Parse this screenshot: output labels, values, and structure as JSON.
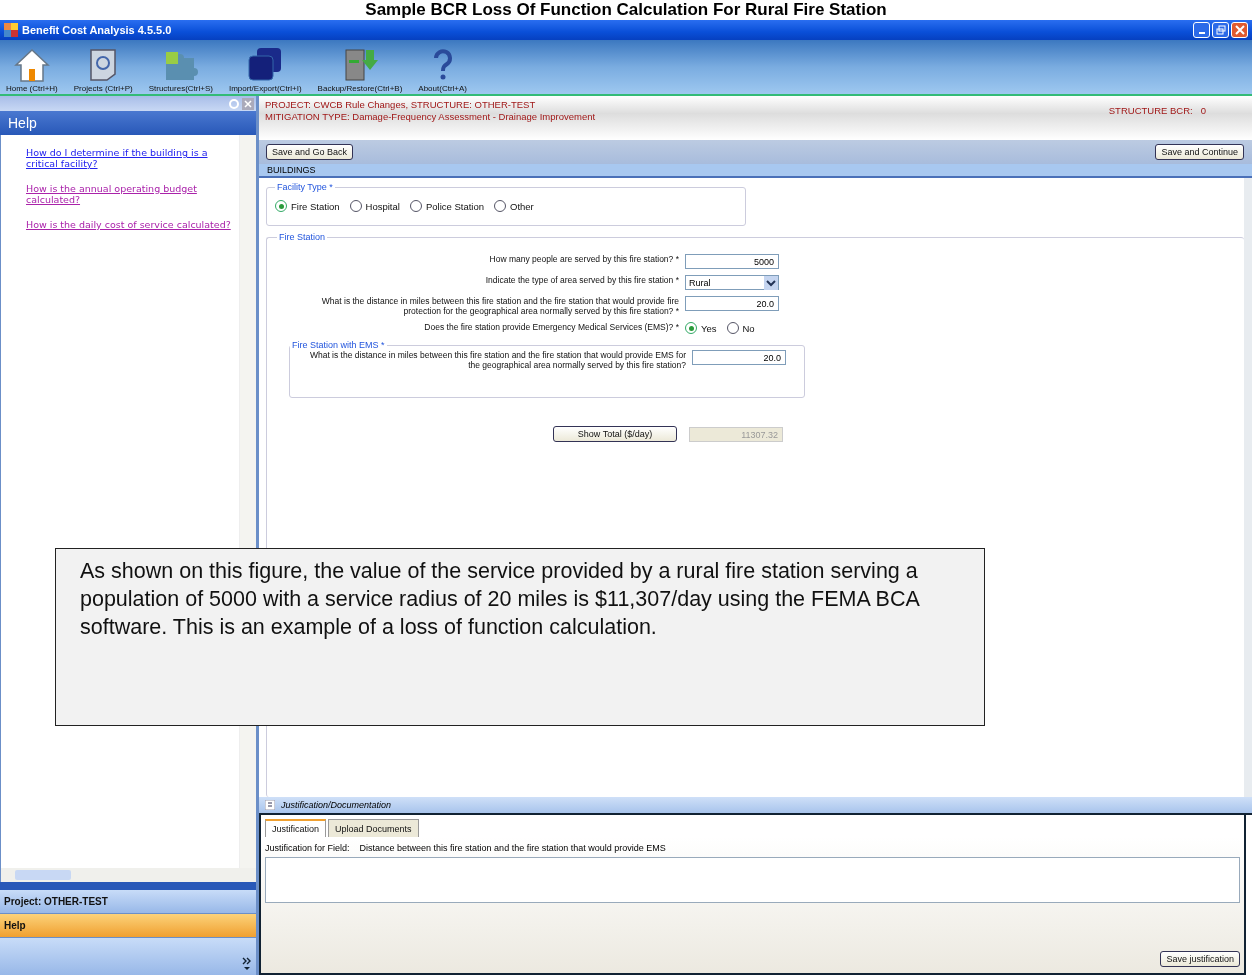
{
  "slide_title": "Sample BCR Loss Of Function Calculation For Rural Fire Station",
  "window": {
    "title": "Benefit Cost Analysis 4.5.5.0"
  },
  "toolbar": [
    {
      "kind": "home",
      "label": "Home (Ctrl+H)"
    },
    {
      "kind": "projects",
      "label": "Projects (Ctrl+P)"
    },
    {
      "kind": "structures",
      "label": "Structures(Ctrl+S)"
    },
    {
      "kind": "import",
      "label": "Import/Export(Ctrl+I)"
    },
    {
      "kind": "backup",
      "label": "Backup/Restore(Ctrl+B)"
    },
    {
      "kind": "about",
      "label": "About(Ctrl+A)"
    }
  ],
  "help_panel": {
    "title": "Help",
    "links": [
      {
        "text": "How do I determine if the building is a critical facility?",
        "visited": false
      },
      {
        "text": "How is the annual operating budget calculated?",
        "visited": true
      },
      {
        "text": "How is the daily cost of service calculated?",
        "visited": true
      }
    ]
  },
  "sidebar_sections": [
    {
      "label": "Project: OTHER-TEST",
      "selected": false
    },
    {
      "label": "Help",
      "selected": true
    }
  ],
  "header": {
    "project": "PROJECT: CWCB Rule Changes, STRUCTURE: OTHER-TEST",
    "mitigation": "MITIGATION TYPE: Damage-Frequency Assessment - Drainage Improvement",
    "bcr_label": "STRUCTURE BCR:",
    "bcr_value": "0"
  },
  "back_button": "Save and Go Back",
  "continue_button": "Save and Continue",
  "section": "BUILDINGS",
  "facility_type": {
    "legend": "Facility Type *",
    "options": [
      {
        "label": "Fire Station",
        "selected": true
      },
      {
        "label": "Hospital",
        "selected": false
      },
      {
        "label": "Police Station",
        "selected": false
      },
      {
        "label": "Other",
        "selected": false
      }
    ]
  },
  "fire_station": {
    "legend": "Fire Station",
    "questions": [
      {
        "kind": "text",
        "label": "How many people are served by this fire station? *",
        "value": "5000"
      },
      {
        "kind": "select",
        "label": "Indicate the type of area served by this fire station *",
        "value": "Rural"
      },
      {
        "kind": "text",
        "label": "What is the distance in miles between this fire station and the fire station that would provide fire protection for the geographical area normally served by this fire station? *",
        "value": "20.0"
      },
      {
        "kind": "radio",
        "label": "Does the fire station provide Emergency Medical Services (EMS)? *",
        "options": [
          {
            "label": "Yes",
            "selected": true
          },
          {
            "label": "No",
            "selected": false
          }
        ]
      }
    ]
  },
  "ems": {
    "legend": "Fire Station with EMS *",
    "label": "What is the distance in miles between this fire station and the fire station that would provide EMS for the geographical area normally served by this fire station?",
    "value": "20.0"
  },
  "total": {
    "button": "Show Total ($/day)",
    "value": "11307.32"
  },
  "callout": "As shown on this figure, the value of the service provided by a rural fire station serving a population of 5000 with a service radius of 20 miles is $11,307/day using the FEMA BCA software.  This is an example of a loss of function calculation.",
  "justification": {
    "title": "Justification/Documentation",
    "tabs": [
      {
        "label": "Justification",
        "selected": true
      },
      {
        "label": "Upload Documents",
        "selected": false
      }
    ],
    "field_label": "Justification for Field:",
    "field_name": "Distance between this fire station and the fire station that would provide EMS",
    "save_button": "Save justification"
  }
}
